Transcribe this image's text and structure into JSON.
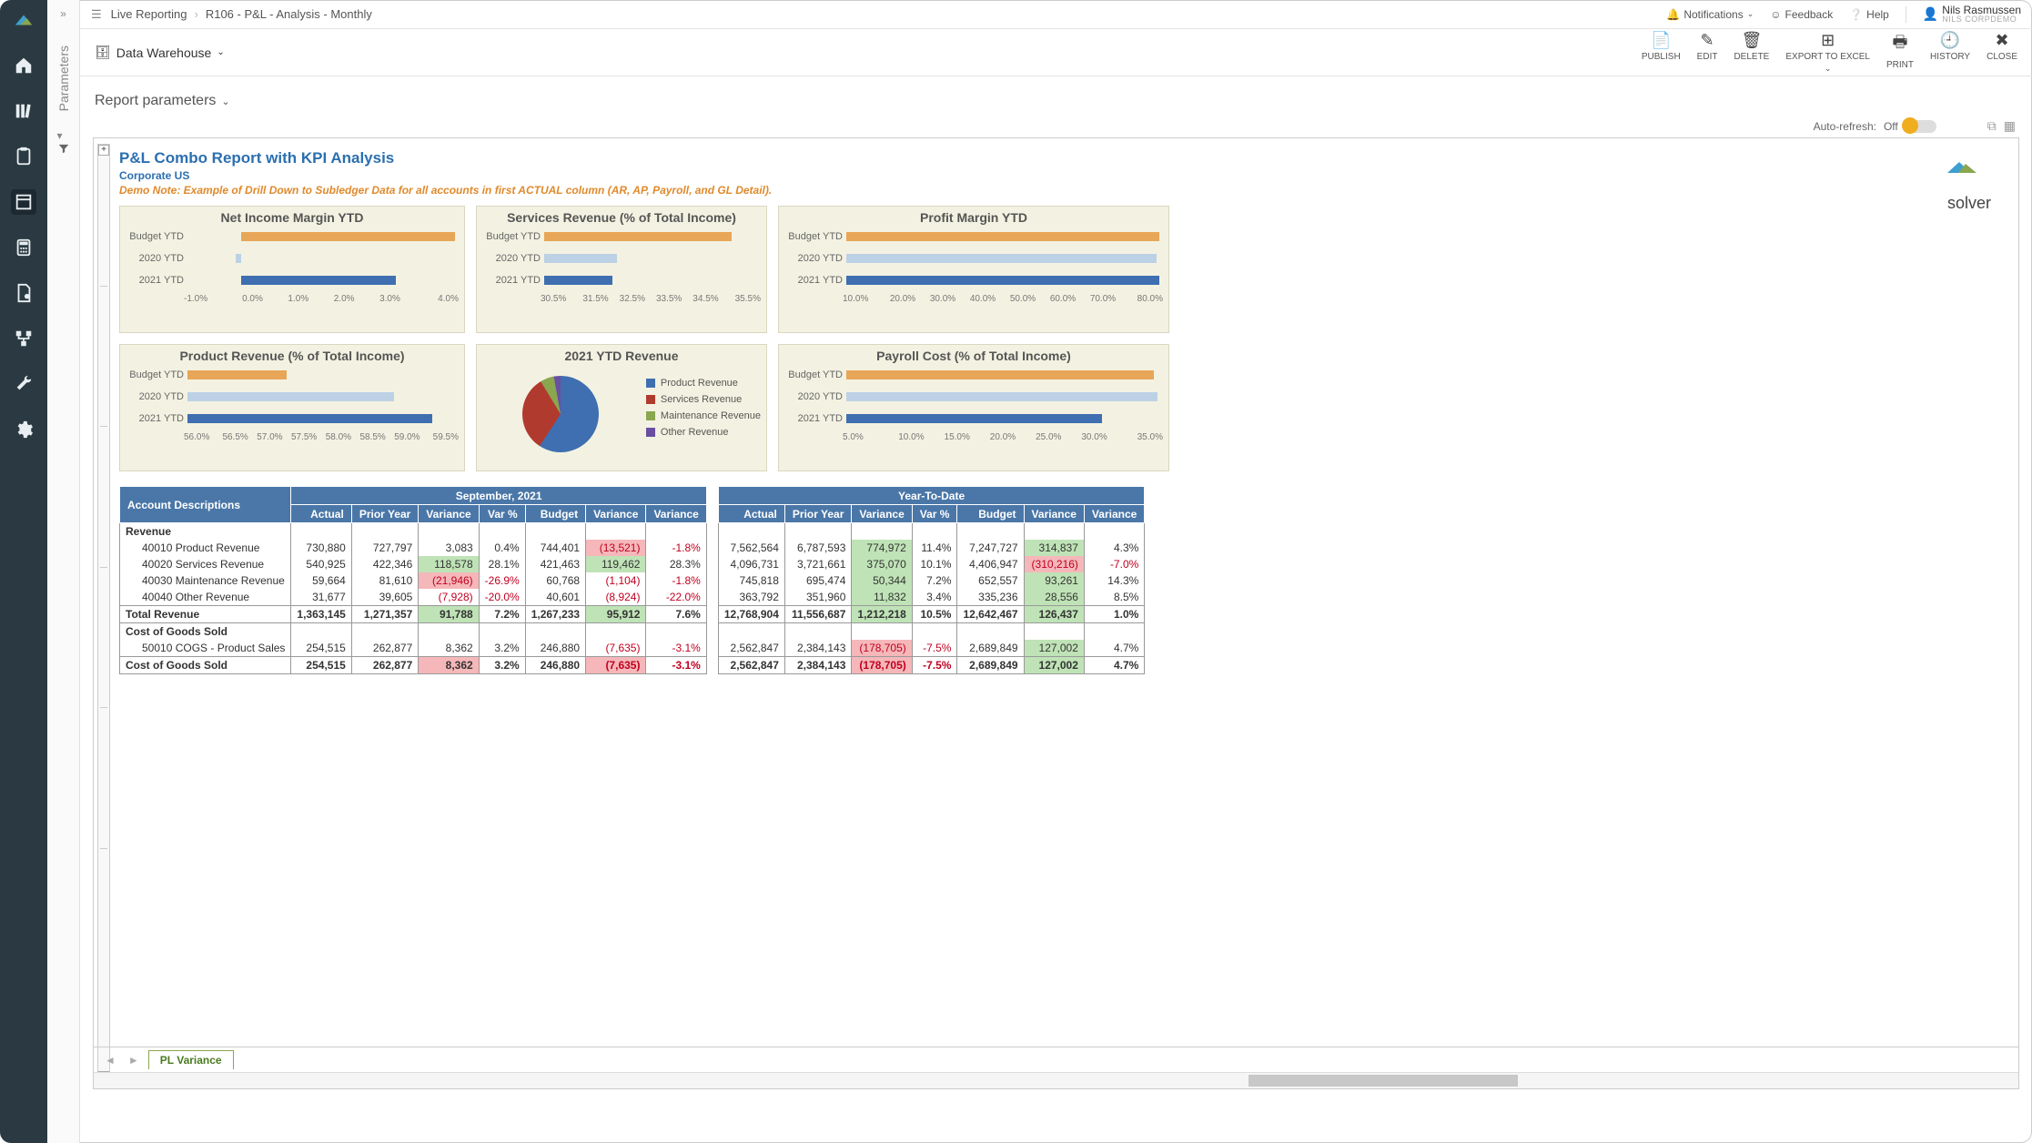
{
  "breadcrumb": {
    "root": "Live Reporting",
    "page": "R106 - P&L - Analysis - Monthly"
  },
  "topbar": {
    "notifications": "Notifications",
    "feedback": "Feedback",
    "help": "Help",
    "user_name": "Nils Rasmussen",
    "user_corp": "NILS CORPDEMO"
  },
  "secondbar": {
    "datasource": "Data Warehouse",
    "actions": {
      "publish": "PUBLISH",
      "edit": "EDIT",
      "delete": "DELETE",
      "export": "EXPORT TO EXCEL",
      "print": "PRINT",
      "history": "HISTORY",
      "close": "CLOSE"
    }
  },
  "parampanel": {
    "label": "Parameters"
  },
  "paramsbar": {
    "label": "Report parameters"
  },
  "autorefresh": {
    "label": "Auto-refresh:",
    "state": "Off"
  },
  "logo": {
    "text": "solver"
  },
  "report": {
    "title": "P&L Combo Report with KPI Analysis",
    "subtitle": "Corporate US",
    "note": "Demo Note: Example of Drill Down to Subledger Data for all accounts in first ACTUAL column (AR, AP, Payroll, and GL Detail)."
  },
  "chart_data": [
    {
      "id": "net_income_margin",
      "type": "bar",
      "orientation": "h",
      "title": "Net Income Margin YTD",
      "categories": [
        "Budget YTD",
        "2020 YTD",
        "2021 YTD"
      ],
      "series": [
        {
          "name": "",
          "values": [
            4.0,
            -0.1,
            2.9
          ],
          "colors": [
            "#e8a658",
            "#bcd1e6",
            "#3f6fb0"
          ]
        }
      ],
      "xlim": [
        -1.0,
        4.0
      ],
      "ticks": [
        "-1.0%",
        "0.0%",
        "1.0%",
        "2.0%",
        "3.0%",
        "4.0%"
      ]
    },
    {
      "id": "services_revenue",
      "type": "bar",
      "orientation": "h",
      "title": "Services Revenue (% of Total Income)",
      "categories": [
        "Budget YTD",
        "2020 YTD",
        "2021 YTD"
      ],
      "series": [
        {
          "name": "",
          "values": [
            34.9,
            32.2,
            32.1
          ],
          "colors": [
            "#e8a658",
            "#bcd1e6",
            "#3f6fb0"
          ]
        }
      ],
      "xlim": [
        30.5,
        35.5
      ],
      "ticks": [
        "30.5%",
        "31.5%",
        "32.5%",
        "33.5%",
        "34.5%",
        "35.5%"
      ]
    },
    {
      "id": "profit_margin",
      "type": "bar",
      "orientation": "h",
      "title": "Profit Margin YTD",
      "categories": [
        "Budget YTD",
        "2020 YTD",
        "2021 YTD"
      ],
      "series": [
        {
          "name": "",
          "values": [
            80.0,
            79.4,
            79.9
          ],
          "colors": [
            "#e8a658",
            "#bcd1e6",
            "#3f6fb0"
          ]
        }
      ],
      "xlim": [
        10.0,
        80.0
      ],
      "ticks": [
        "10.0%",
        "20.0%",
        "30.0%",
        "40.0%",
        "50.0%",
        "60.0%",
        "70.0%",
        "80.0%"
      ]
    },
    {
      "id": "product_revenue",
      "type": "bar",
      "orientation": "h",
      "title": "Product Revenue (% of Total Income)",
      "categories": [
        "Budget YTD",
        "2020 YTD",
        "2021 YTD"
      ],
      "series": [
        {
          "name": "",
          "values": [
            57.3,
            58.7,
            59.2
          ],
          "colors": [
            "#e8a658",
            "#bcd1e6",
            "#3f6fb0"
          ]
        }
      ],
      "xlim": [
        56.0,
        59.5
      ],
      "ticks": [
        "56.0%",
        "56.5%",
        "57.0%",
        "57.5%",
        "58.0%",
        "58.5%",
        "59.0%",
        "59.5%"
      ]
    },
    {
      "id": "ytd_revenue",
      "type": "pie",
      "title": "2021 YTD Revenue",
      "labels": [
        "Product Revenue",
        "Services Revenue",
        "Maintenance Revenue",
        "Other Revenue"
      ],
      "values": [
        7562564,
        4096731,
        745818,
        363792
      ],
      "colors": [
        "#3f6fb0",
        "#b13a2e",
        "#8aa64f",
        "#6a4fa0"
      ]
    },
    {
      "id": "payroll_cost",
      "type": "bar",
      "orientation": "h",
      "title": "Payroll Cost (% of Total Income)",
      "categories": [
        "Budget YTD",
        "2020 YTD",
        "2021 YTD"
      ],
      "series": [
        {
          "name": "",
          "values": [
            34.5,
            34.8,
            29.5
          ],
          "colors": [
            "#e8a658",
            "#bcd1e6",
            "#3f6fb0"
          ]
        }
      ],
      "xlim": [
        5.0,
        35.0
      ],
      "ticks": [
        "5.0%",
        "10.0%",
        "15.0%",
        "20.0%",
        "25.0%",
        "30.0%",
        "35.0%"
      ]
    }
  ],
  "table": {
    "period_group": "September, 2021",
    "ytd_group": "Year-To-Date",
    "cols": [
      "Account Descriptions",
      "Actual",
      "Prior Year",
      "Variance",
      "Var %",
      "Budget",
      "Variance",
      "Variance",
      "Actual",
      "Prior Year",
      "Variance",
      "Var %",
      "Budget",
      "Variance",
      "Variance"
    ],
    "sections": [
      {
        "label": "Revenue",
        "rows": [
          {
            "acct": "40010 Product Revenue",
            "m": [
              "730,880",
              "727,797",
              "3,083",
              "0.4%",
              "744,401",
              "(13,521)",
              "-1.8%"
            ],
            "mhl": [
              "",
              "",
              "",
              "",
              "",
              "r",
              ""
            ],
            "y": [
              "7,562,564",
              "6,787,593",
              "774,972",
              "11.4%",
              "7,247,727",
              "314,837",
              "4.3%"
            ],
            "yhl": [
              "",
              "",
              "g",
              "",
              "",
              "g",
              ""
            ]
          },
          {
            "acct": "40020 Services Revenue",
            "m": [
              "540,925",
              "422,346",
              "118,578",
              "28.1%",
              "421,463",
              "119,462",
              "28.3%"
            ],
            "mhl": [
              "",
              "",
              "g",
              "",
              "",
              "g",
              ""
            ],
            "y": [
              "4,096,731",
              "3,721,661",
              "375,070",
              "10.1%",
              "4,406,947",
              "(310,216)",
              "-7.0%"
            ],
            "yhl": [
              "",
              "",
              "g",
              "",
              "",
              "r",
              ""
            ]
          },
          {
            "acct": "40030 Maintenance Revenue",
            "m": [
              "59,664",
              "81,610",
              "(21,946)",
              "-26.9%",
              "60,768",
              "(1,104)",
              "-1.8%"
            ],
            "mhl": [
              "",
              "",
              "r",
              "",
              "",
              "",
              ""
            ],
            "y": [
              "745,818",
              "695,474",
              "50,344",
              "7.2%",
              "652,557",
              "93,261",
              "14.3%"
            ],
            "yhl": [
              "",
              "",
              "g",
              "",
              "",
              "g",
              ""
            ]
          },
          {
            "acct": "40040 Other Revenue",
            "m": [
              "31,677",
              "39,605",
              "(7,928)",
              "-20.0%",
              "40,601",
              "(8,924)",
              "-22.0%"
            ],
            "mhl": [
              "",
              "",
              "",
              "",
              "",
              "",
              ""
            ],
            "y": [
              "363,792",
              "351,960",
              "11,832",
              "3.4%",
              "335,236",
              "28,556",
              "8.5%"
            ],
            "yhl": [
              "",
              "",
              "g",
              "",
              "",
              "g",
              ""
            ]
          }
        ],
        "total": {
          "acct": "Total Revenue",
          "m": [
            "1,363,145",
            "1,271,357",
            "91,788",
            "7.2%",
            "1,267,233",
            "95,912",
            "7.6%"
          ],
          "mhl": [
            "",
            "",
            "g",
            "",
            "",
            "g",
            ""
          ],
          "y": [
            "12,768,904",
            "11,556,687",
            "1,212,218",
            "10.5%",
            "12,642,467",
            "126,437",
            "1.0%"
          ],
          "yhl": [
            "",
            "",
            "g",
            "",
            "",
            "g",
            ""
          ]
        }
      },
      {
        "label": "Cost of Goods Sold",
        "rows": [
          {
            "acct": "50010 COGS - Product Sales",
            "m": [
              "254,515",
              "262,877",
              "8,362",
              "3.2%",
              "246,880",
              "(7,635)",
              "-3.1%"
            ],
            "mhl": [
              "",
              "",
              "",
              "",
              "",
              "",
              ""
            ],
            "y": [
              "2,562,847",
              "2,384,143",
              "(178,705)",
              "-7.5%",
              "2,689,849",
              "127,002",
              "4.7%"
            ],
            "yhl": [
              "",
              "",
              "r",
              "",
              "",
              "g",
              ""
            ]
          }
        ],
        "total": {
          "acct": "Cost of Goods Sold",
          "m": [
            "254,515",
            "262,877",
            "8,362",
            "3.2%",
            "246,880",
            "(7,635)",
            "-3.1%"
          ],
          "mhl": [
            "",
            "",
            "r",
            "",
            "",
            "r",
            ""
          ],
          "y": [
            "2,562,847",
            "2,384,143",
            "(178,705)",
            "-7.5%",
            "2,689,849",
            "127,002",
            "4.7%"
          ],
          "yhl": [
            "",
            "",
            "r",
            "",
            "",
            "g",
            ""
          ]
        }
      }
    ]
  },
  "tabstrip": {
    "tab": "PL Variance"
  }
}
